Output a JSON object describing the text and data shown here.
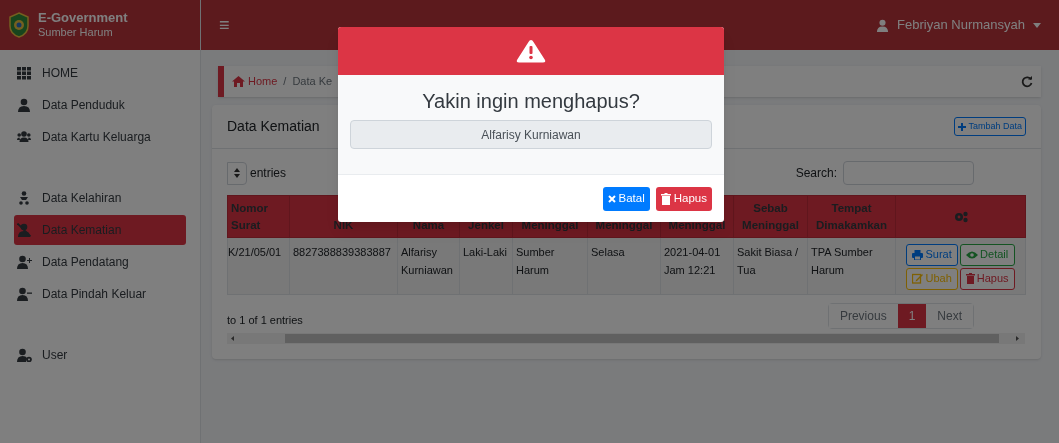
{
  "brand": {
    "title": "E-Government",
    "subtitle": "Sumber Harum"
  },
  "topbar": {
    "menu_glyph": "≡",
    "user": "Febriyan Nurmansyah"
  },
  "sidebar": {
    "groups": [
      {
        "items": [
          {
            "label": "HOME",
            "kind": "grid",
            "selected": false
          },
          {
            "label": "Data Penduduk",
            "kind": "user",
            "selected": false
          },
          {
            "label": "Data Kartu Keluarga",
            "kind": "users",
            "selected": false
          }
        ]
      },
      {
        "items": [
          {
            "label": "Data Kelahiran",
            "kind": "baby",
            "selected": false
          },
          {
            "label": "Data Kematian",
            "kind": "user-slash",
            "selected": true
          },
          {
            "label": "Data Pendatang",
            "kind": "user-plus",
            "selected": false
          },
          {
            "label": "Data Pindah Keluar",
            "kind": "user-minus",
            "selected": false
          }
        ]
      },
      {
        "items": [
          {
            "label": "User",
            "kind": "user-cog",
            "selected": false
          }
        ]
      }
    ]
  },
  "breadcrumb": {
    "home": "Home",
    "separator": "/",
    "current": "Data Ke"
  },
  "card": {
    "title": "Data Kematian",
    "add_button": "Tambah Data",
    "entries_label": "entries",
    "search_label": "Search:",
    "table": {
      "columns": [
        "Nomor Surat",
        "NIK",
        "Nama",
        "Jenkel",
        "Meninggal",
        "Meninggal",
        "Meninggal",
        "Sebab Meninggal",
        "Tempat Dimakamkan"
      ],
      "rows": [
        {
          "cells": [
            "K/21/05/01",
            "8827388839383887",
            "Alfarisy Kurniawan",
            "Laki-Laki",
            "Sumber Harum",
            "Selasa",
            "2021-04-01 Jam 12:21",
            "Sakit Biasa / Tua",
            "TPA Sumber Harum"
          ],
          "actions": [
            {
              "label": "Surat",
              "kind": "print"
            },
            {
              "label": "Detail",
              "kind": "detail"
            },
            {
              "label": "Ubah",
              "kind": "edit"
            },
            {
              "label": "Hapus",
              "kind": "delete"
            }
          ]
        }
      ]
    },
    "info": "to 1 of 1 entries",
    "pagination": [
      {
        "label": "Previous",
        "selected": false
      },
      {
        "label": "1",
        "selected": true
      },
      {
        "label": "Next",
        "selected": false
      }
    ]
  },
  "modal": {
    "title": "Yakin ingin menghapus?",
    "name": "Alfarisy Kurniawan",
    "buttons": [
      {
        "label": "Batal",
        "kind": "cancel"
      },
      {
        "label": "Hapus",
        "kind": "delete"
      }
    ]
  }
}
